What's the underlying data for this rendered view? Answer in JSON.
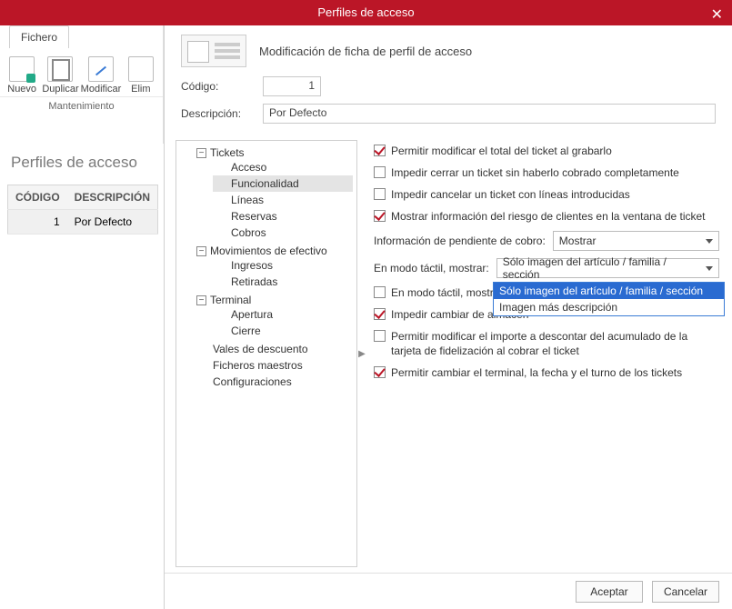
{
  "titlebar": {
    "title": "Perfiles de acceso"
  },
  "ribbon": {
    "file_tab": "Fichero",
    "new": "Nuevo",
    "duplicate": "Duplicar",
    "modify": "Modificar",
    "delete": "Elim",
    "group": "Mantenimiento"
  },
  "left_page": {
    "heading": "Perfiles de acceso",
    "cols": {
      "code": "CÓDIGO",
      "desc": "DESCRIPCIÓN"
    },
    "row": {
      "code": "1",
      "desc": "Por Defecto"
    }
  },
  "dialog": {
    "subtitle": "Modificación de ficha de perfil de acceso",
    "code_label": "Código:",
    "code_value": "1",
    "desc_label": "Descripción:",
    "desc_value": "Por Defecto"
  },
  "tree": {
    "n0": "Tickets",
    "n0_0": "Acceso",
    "n0_1": "Funcionalidad",
    "n0_2": "Líneas",
    "n0_3": "Reservas",
    "n0_4": "Cobros",
    "n1": "Movimientos de efectivo",
    "n1_0": "Ingresos",
    "n1_1": "Retiradas",
    "n2": "Terminal",
    "n2_0": "Apertura",
    "n2_1": "Cierre",
    "n3": "Vales de descuento",
    "n4": "Ficheros maestros",
    "n5": "Configuraciones"
  },
  "opts": {
    "c1": "Permitir modificar el total del ticket al grabarlo",
    "c2": "Impedir cerrar un ticket sin haberlo cobrado completamente",
    "c3": "Impedir cancelar un ticket con líneas introducidas",
    "c4": "Mostrar información del riesgo de clientes en la ventana de ticket",
    "sel1_label": "Información de pendiente de cobro:",
    "sel1_value": "Mostrar",
    "sel2_label": "En modo táctil, mostrar:",
    "sel2_value": "Sólo imagen del artículo / familia / sección",
    "c5": "En modo táctil, mostrar",
    "c6": "Impedir cambiar de almacén",
    "c7": "Permitir modificar el importe a descontar del acumulado de la tarjeta de fidelización al cobrar el ticket",
    "c8": "Permitir cambiar el terminal, la fecha y el turno de los tickets",
    "dd_opt1": "Sólo imagen del artículo / familia / sección",
    "dd_opt2": "Imagen más descripción"
  },
  "footer": {
    "ok": "Aceptar",
    "cancel": "Cancelar"
  }
}
